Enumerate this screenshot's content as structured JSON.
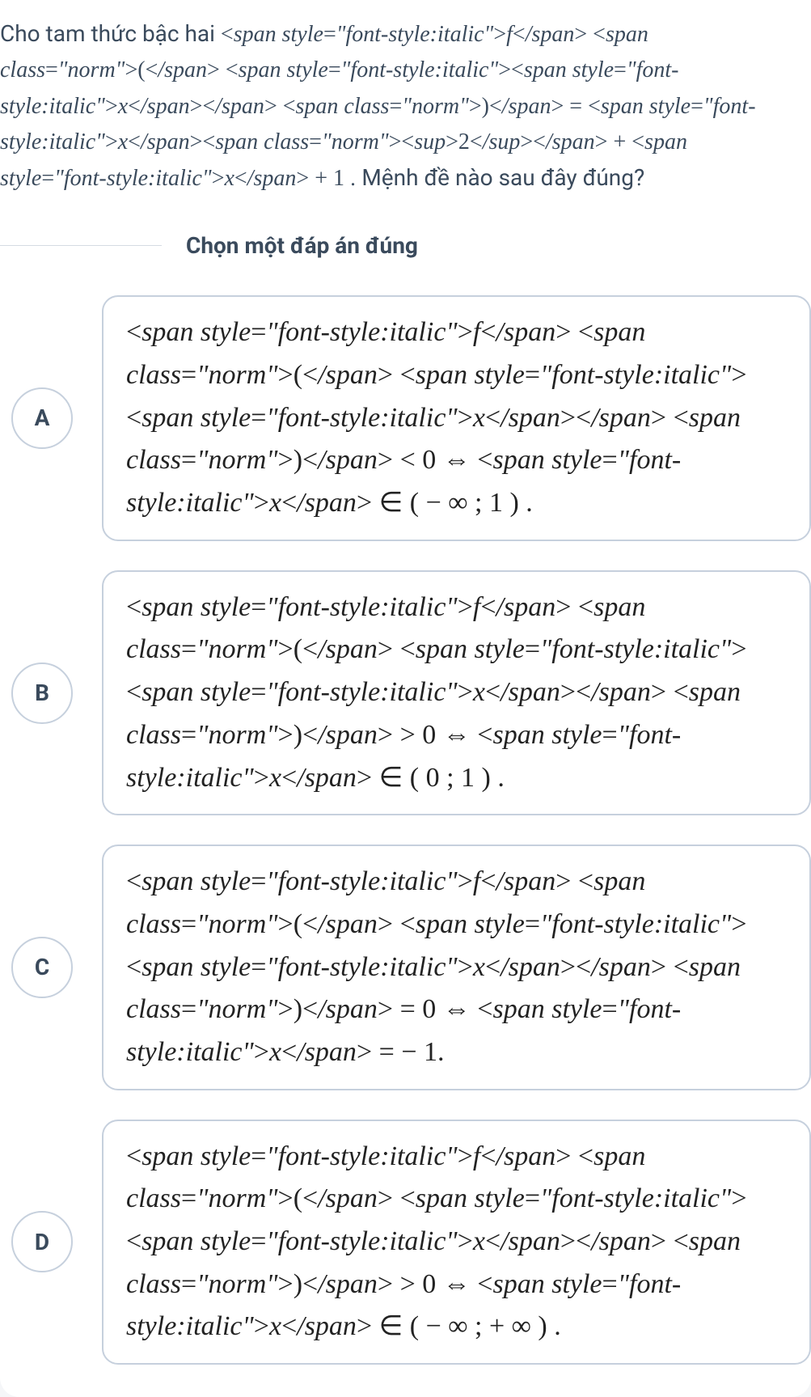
{
  "question": {
    "prefix": "Cho tam thức bậc hai ",
    "fx_html": "f ( x ) = x<sup>2</sup> + x + 1",
    "suffix": ". Mệnh đề nào sau đây đúng?"
  },
  "prompt": "Chọn một đáp án đúng",
  "options": [
    {
      "label": "A",
      "expr_html": "f ( x ) < 0 ⇔ x ∈ ( − ∞ ; 1 ) ."
    },
    {
      "label": "B",
      "expr_html": "f ( x ) > 0 ⇔ x ∈ ( 0 ; 1 ) ."
    },
    {
      "label": "C",
      "expr_html": "f ( x ) = 0 ⇔ x = − 1."
    },
    {
      "label": "D",
      "expr_html": "f ( x ) > 0 ⇔ x ∈ ( − ∞ ; + ∞ ) ."
    }
  ]
}
